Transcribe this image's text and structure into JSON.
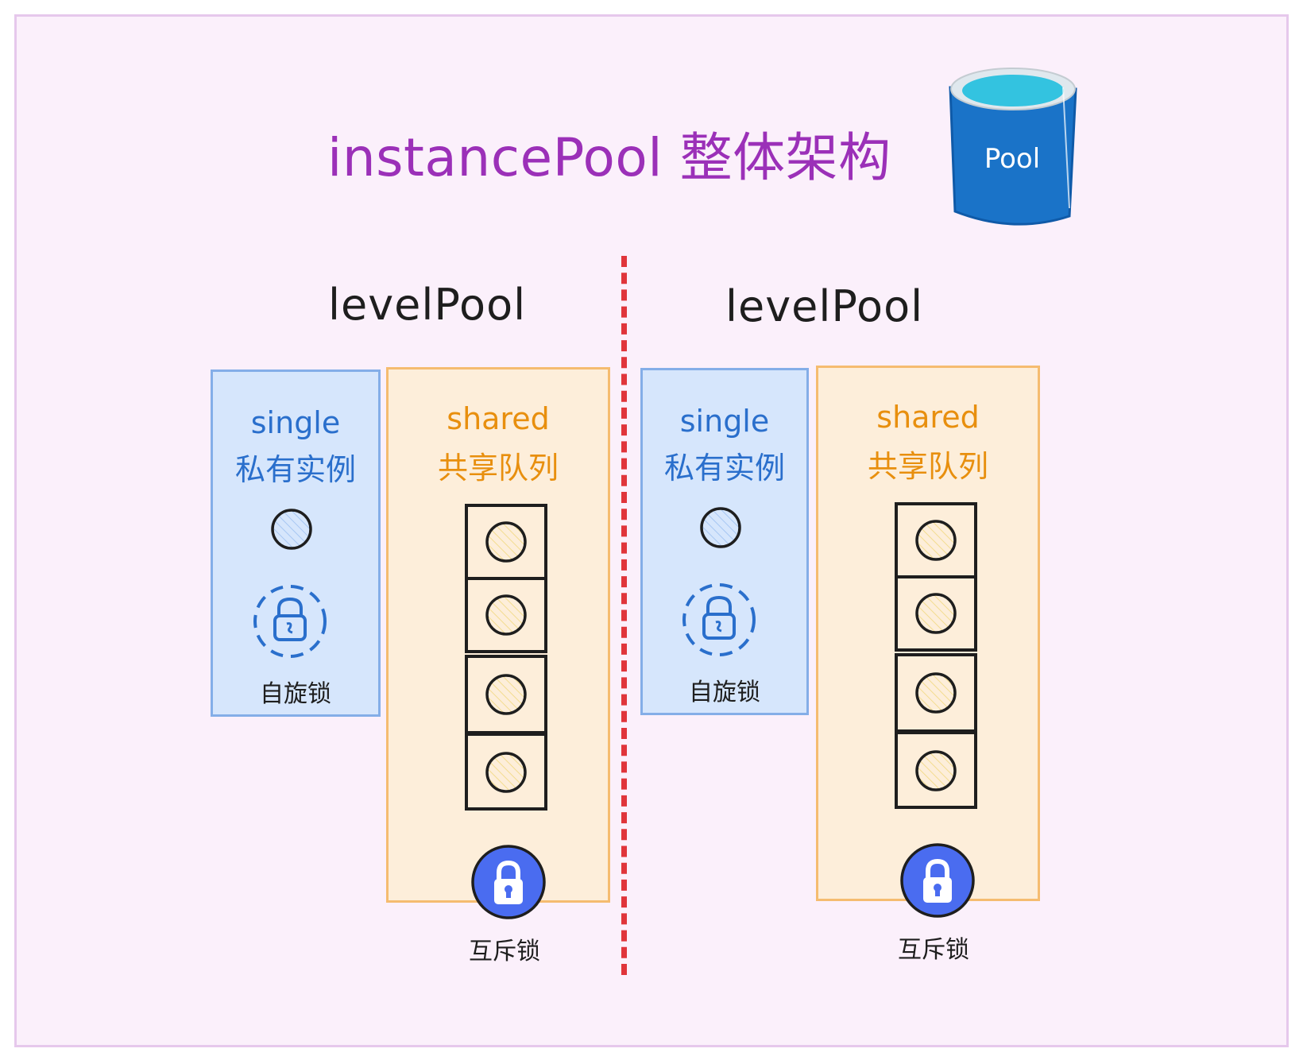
{
  "title": "instancePool 整体架构",
  "pool_icon_label": "Pool",
  "left": {
    "level_label": "levelPool",
    "single_en": "single",
    "single_zh": "私有实例",
    "spin_lock_label": "自旋锁",
    "shared_en": "shared",
    "shared_zh": "共享队列",
    "mutex_label": "互斥锁",
    "queue_slots": 4
  },
  "right": {
    "level_label": "levelPool",
    "single_en": "single",
    "single_zh": "私有实例",
    "spin_lock_label": "自旋锁",
    "shared_en": "shared",
    "shared_zh": "共享队列",
    "mutex_label": "互斥锁",
    "queue_slots": 4
  },
  "colors": {
    "title": "#9b30b8",
    "single_fill": "#d6e6fc",
    "single_stroke": "#84aee8",
    "shared_fill": "#fdeeda",
    "shared_stroke": "#f5bc70",
    "divider": "#e0353b",
    "pool_blue": "#1a73c8",
    "pool_water": "#33c3e0",
    "mutex_fill": "#4a6cf0"
  }
}
